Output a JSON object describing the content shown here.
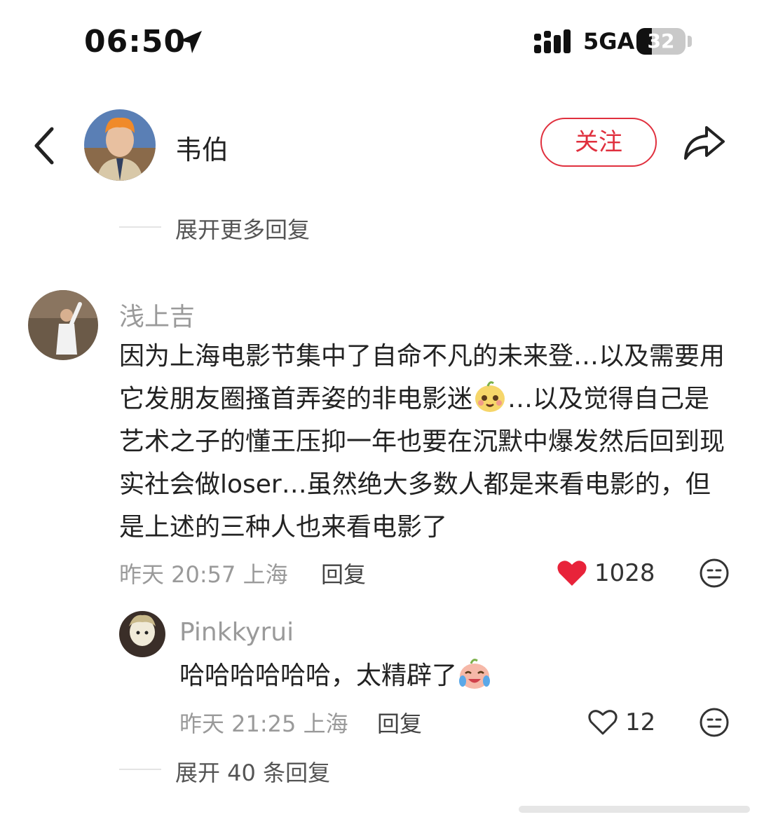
{
  "status_bar": {
    "time": "06:50",
    "network": "5GA",
    "battery": "32",
    "battery_level": 0.32
  },
  "header": {
    "name": "韦伯",
    "follow_label": "关注"
  },
  "expand_more": {
    "label": "展开更多回复"
  },
  "comment": {
    "username": "浅上吉",
    "text_part1": "因为上海电影节集中了自命不凡的未来登…以及需要用它发朋友圈搔首弄姿的非电影迷",
    "text_part2": "…以及觉得自己是艺术之子的懂王压抑一年也要在沉默中爆发然后回到现实社会做loser…虽然绝大多数人都是来看电影的，但是上述的三种人也来看电影了",
    "timestamp": "昨天 20:57 上海",
    "reply_label": "回复",
    "likes": "1028"
  },
  "reply": {
    "username": "Pinkkyrui",
    "text": "哈哈哈哈哈哈，太精辟了",
    "timestamp": "昨天 21:25 上海",
    "reply_label": "回复",
    "likes": "12"
  },
  "expand_replies": {
    "label": "展开 40 条回复"
  },
  "colors": {
    "accent_red": "#e0303e",
    "muted_text": "#9a9a9a"
  },
  "icons": {
    "location": "location-arrow-icon",
    "back": "chevron-left-icon",
    "share": "share-arrow-icon",
    "like_filled": "heart-filled-icon",
    "like_outline": "heart-outline-icon",
    "reaction": "neutral-face-icon"
  }
}
